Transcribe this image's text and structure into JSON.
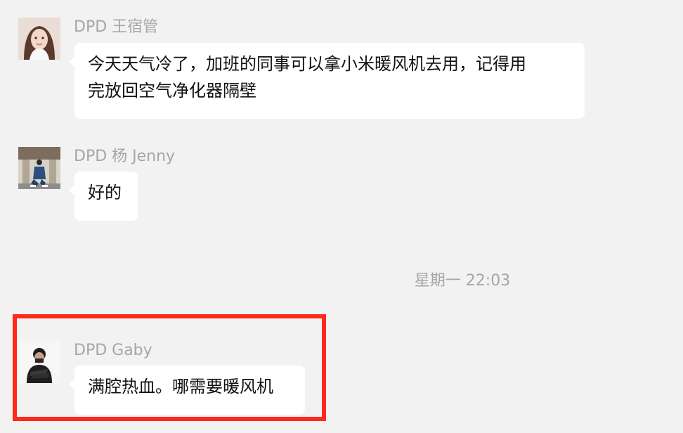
{
  "messages": [
    {
      "sender": "DPD 王宿管",
      "lines": [
        "今天天气冷了，加班的同事可以拿小米暖风机去用，记得用",
        "完放回空气净化器隔壁"
      ]
    },
    {
      "sender": "DPD 杨 Jenny",
      "lines": [
        "好的"
      ]
    },
    {
      "sender": "DPD Gaby",
      "lines": [
        "满腔热血。哪需要暖风机"
      ]
    }
  ],
  "timestamp": "星期一 22:03",
  "colors": {
    "background": "#f2f2f2",
    "bubble": "#ffffff",
    "meta_text": "#a6a6a6",
    "message_text": "#111111",
    "highlight": "#ff2a1a"
  }
}
